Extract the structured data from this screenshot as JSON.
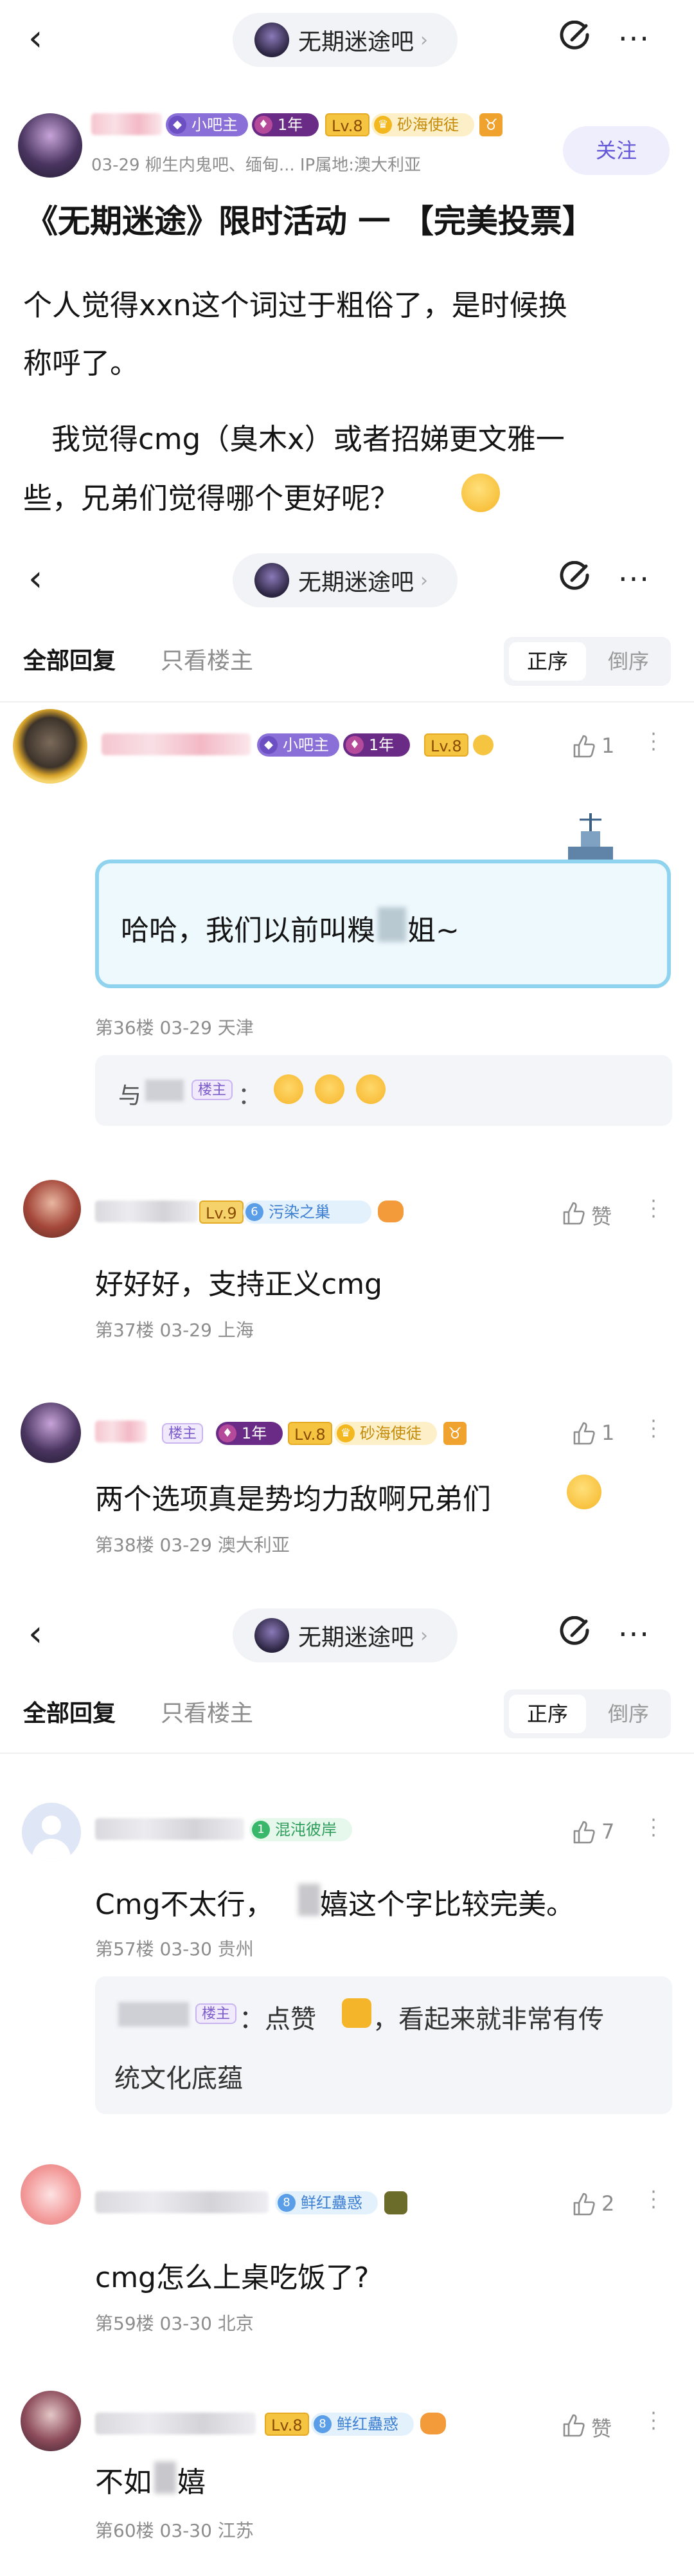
{
  "header": {
    "back_glyph": "‹",
    "forum_name": "无期迷途吧",
    "chevron": "›",
    "more_glyph": "···"
  },
  "post": {
    "level": "Lv.8",
    "title_badge": "小吧主",
    "age_badge": "1年",
    "fan_badge": "砂海使徒",
    "meta": "03-29   柳生内鬼吧、缅甸...  IP属地:澳大利亚",
    "follow_label": "关注",
    "title": "《无期迷途》限时活动 一 【完美投票】",
    "para1_line1": "个人觉得xxn这个词过于粗俗了，是时候换",
    "para1_line2": "称呼了。",
    "para2_line1": "我觉得cmg（臭木x）或者招娣更文雅一",
    "para2_line2": "些，兄弟们觉得哪个更好呢？"
  },
  "tabs": {
    "all": "全部回复",
    "owner_only": "只看楼主",
    "sort_asc": "正序",
    "sort_desc": "倒序"
  },
  "replies_a": [
    {
      "title_badge": "小吧主",
      "age_badge": "1年",
      "level": "Lv.8",
      "likes": "1",
      "text": "哈哈，我们以前叫糗",
      "text_tail": "姐~",
      "meta": "第36楼  03-29  天津",
      "sub_name": "与",
      "sub_owner": "楼主",
      "sub_colon": "："
    },
    {
      "level": "Lv.9",
      "badge_num": "6",
      "badge": "污染之巢",
      "likes": "赞",
      "text": "好好好，支持正义cmg",
      "meta": "第37楼  03-29  上海"
    },
    {
      "owner": "楼主",
      "age_badge": "1年",
      "level": "Lv.8",
      "fan_badge": "砂海使徒",
      "likes": "1",
      "text": "两个选项真是势均力敌啊兄弟们",
      "meta": "第38楼  03-29  澳大利亚"
    }
  ],
  "replies_b": [
    {
      "badge_num": "1",
      "badge": "混沌彼岸",
      "likes": "7",
      "text": "Cmg不太行，",
      "text_tail": "嬉这个字比较完美。",
      "meta": "第57楼  03-30  贵州",
      "sub_owner": "楼主",
      "sub_line1": "：点赞",
      "sub_line1b": "，看起来就非常有传",
      "sub_line2": "统文化底蕴"
    },
    {
      "badge_num": "8",
      "badge": "鲜红蠱惑",
      "likes": "2",
      "text": "cmg怎么上桌吃饭了?",
      "meta": "第59楼  03-30  北京"
    },
    {
      "level": "Lv.8",
      "badge_num": "8",
      "badge": "鲜红蠱惑",
      "likes": "赞",
      "text": "不如",
      "text_tail": "嬉",
      "meta": "第60楼  03-30  江苏"
    }
  ],
  "colors": {
    "accent_purple": "#7b5bc9",
    "bubble_border": "#8fd3ef",
    "bubble_fill": "#eef9fd",
    "level_gold": "#f5c542"
  }
}
